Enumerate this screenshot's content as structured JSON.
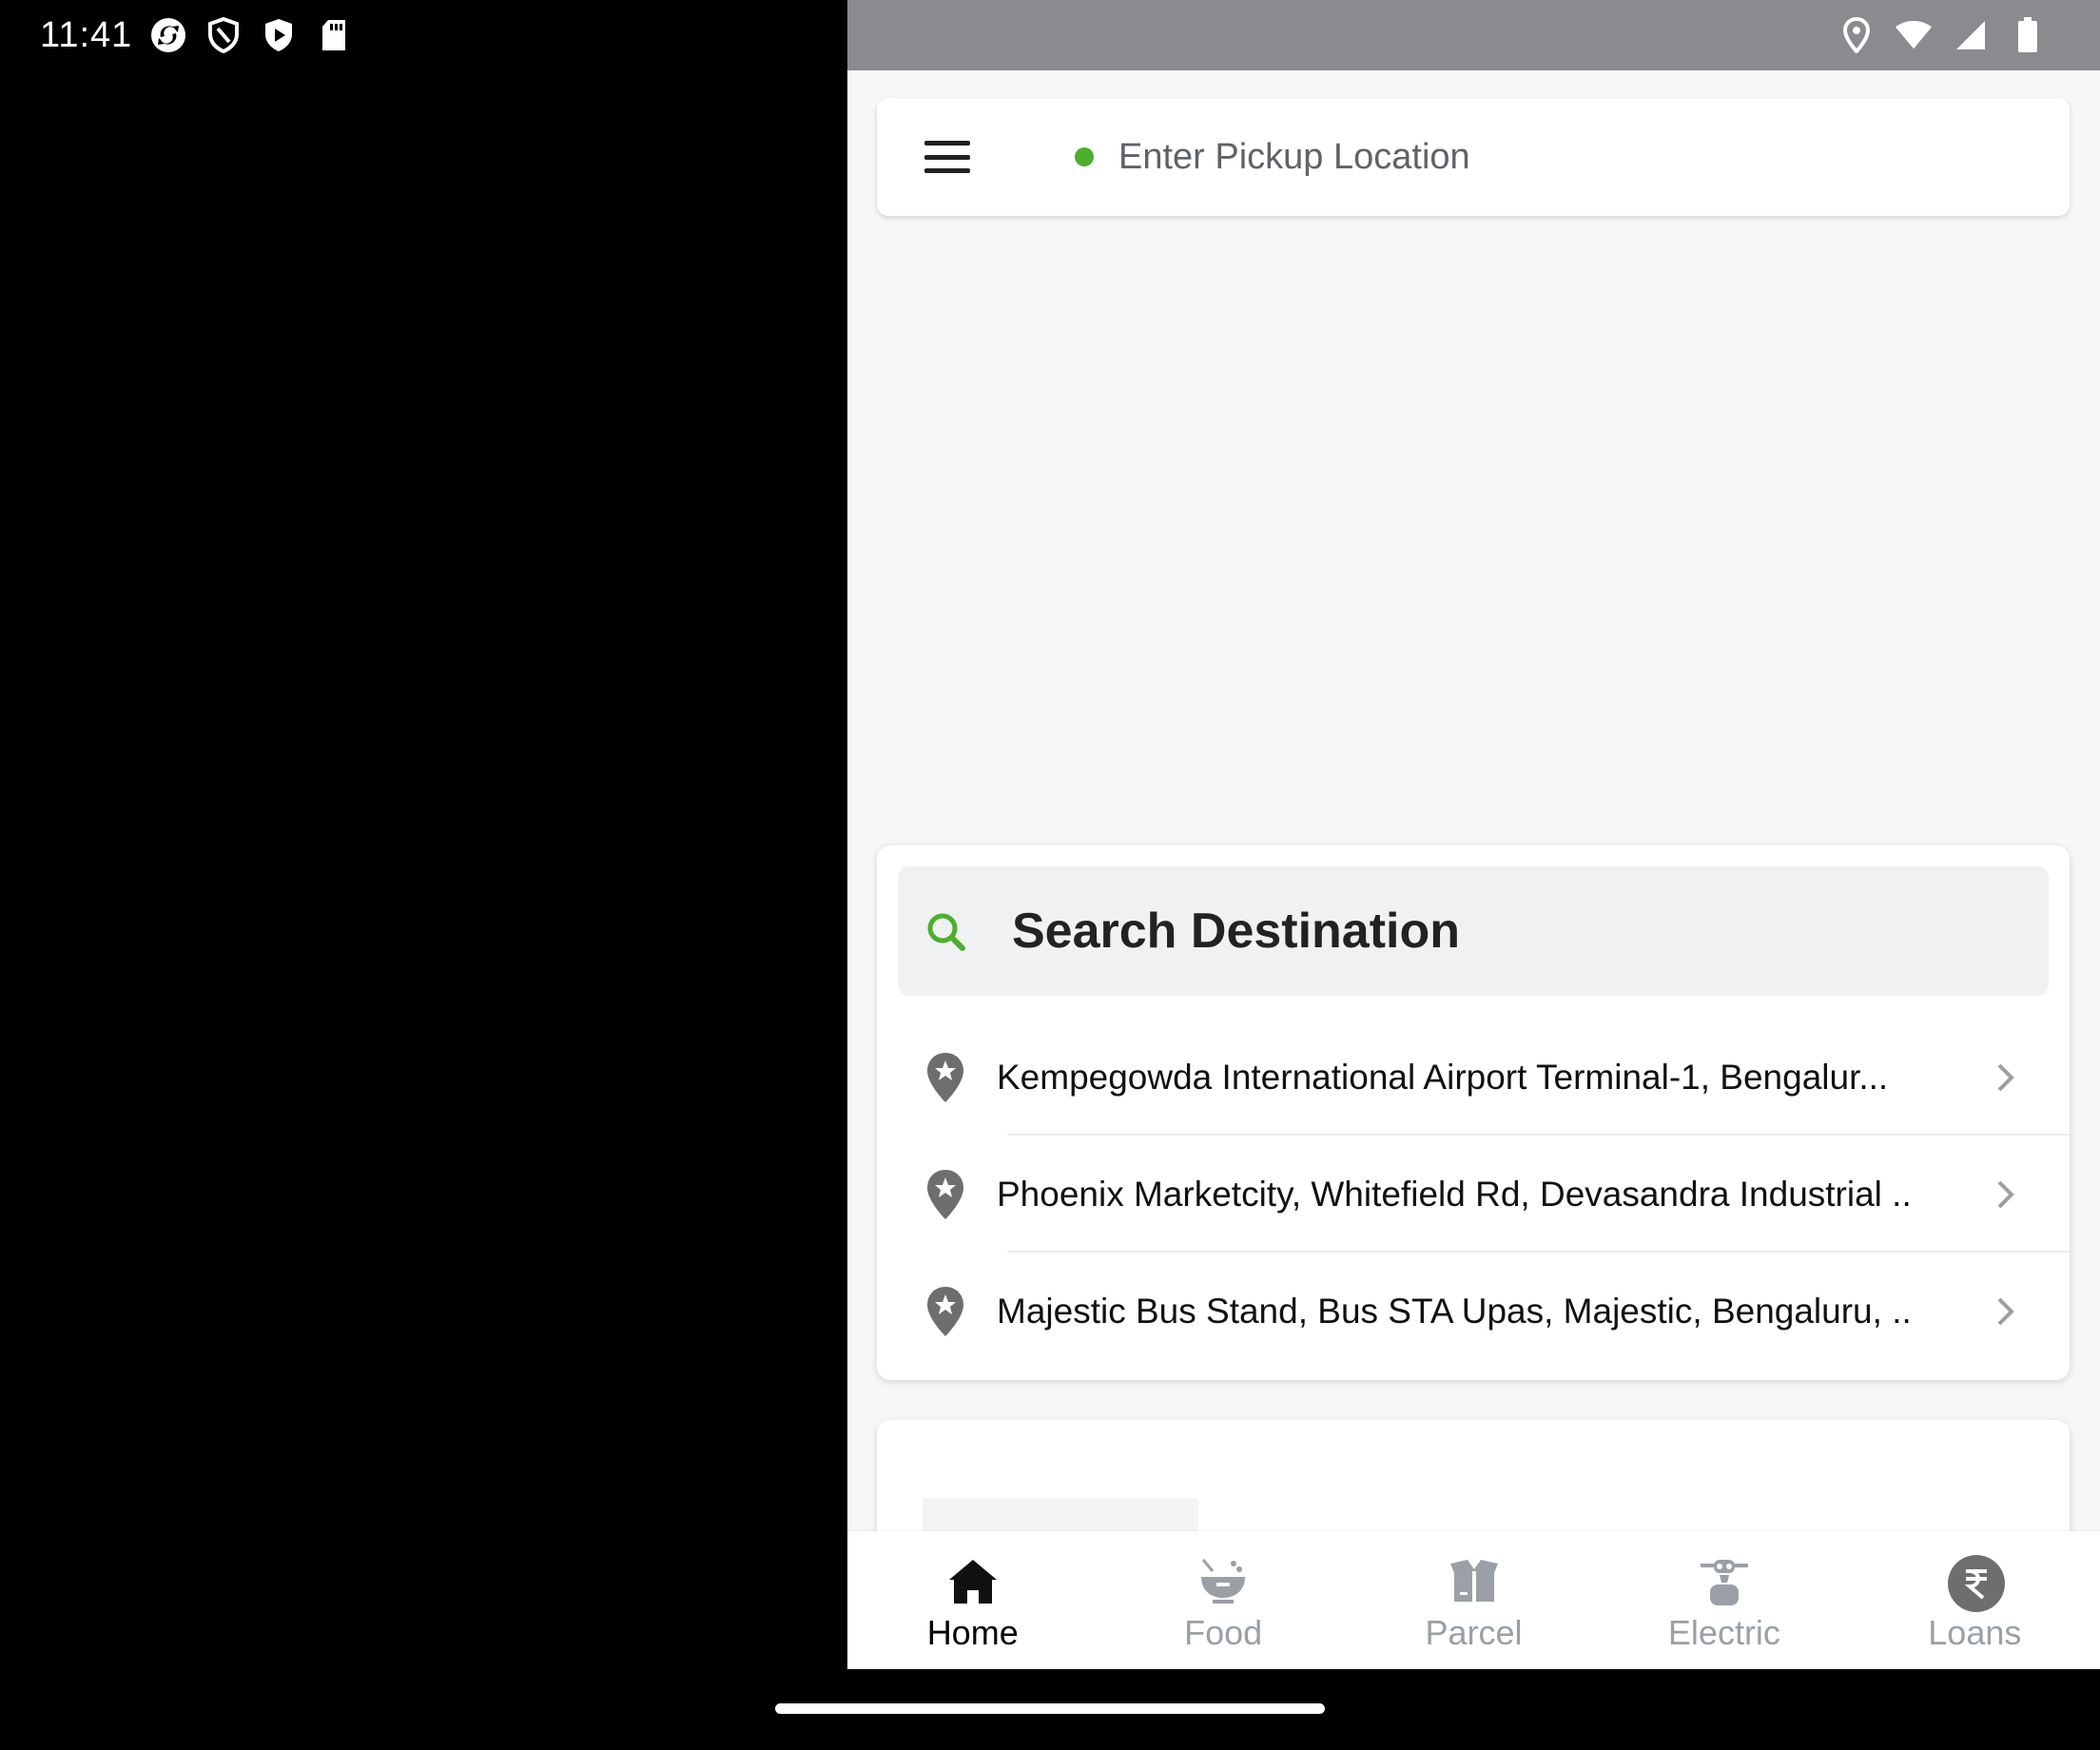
{
  "status_bar": {
    "time": "11:41",
    "left_icons": [
      "sync-icon",
      "shield-icon",
      "play-shield-icon",
      "sd-card-icon"
    ],
    "right_icons": [
      "location-icon",
      "wifi-icon",
      "signal-icon",
      "battery-icon"
    ]
  },
  "pickup": {
    "placeholder": "Enter Pickup Location",
    "dot_color": "#4caf2f"
  },
  "destination": {
    "search_label": "Search Destination",
    "accent": "#4caf2f",
    "recent": [
      {
        "label": "Kempegowda International Airport Terminal-1, Bengalur..."
      },
      {
        "label": "Phoenix Marketcity, Whitefield Rd, Devasandra Industrial ..."
      },
      {
        "label": "Majestic Bus Stand, Bus STA Upas, Majestic, Bengaluru, ..."
      }
    ]
  },
  "bottom_nav": {
    "items": [
      {
        "label": "Home",
        "icon": "home-icon",
        "active": true
      },
      {
        "label": "Food",
        "icon": "food-bowl-icon",
        "active": false
      },
      {
        "label": "Parcel",
        "icon": "parcel-box-icon",
        "active": false
      },
      {
        "label": "Electric",
        "icon": "electric-scooter-icon",
        "active": false
      },
      {
        "label": "Loans",
        "icon": "rupee-icon",
        "active": false
      }
    ]
  }
}
